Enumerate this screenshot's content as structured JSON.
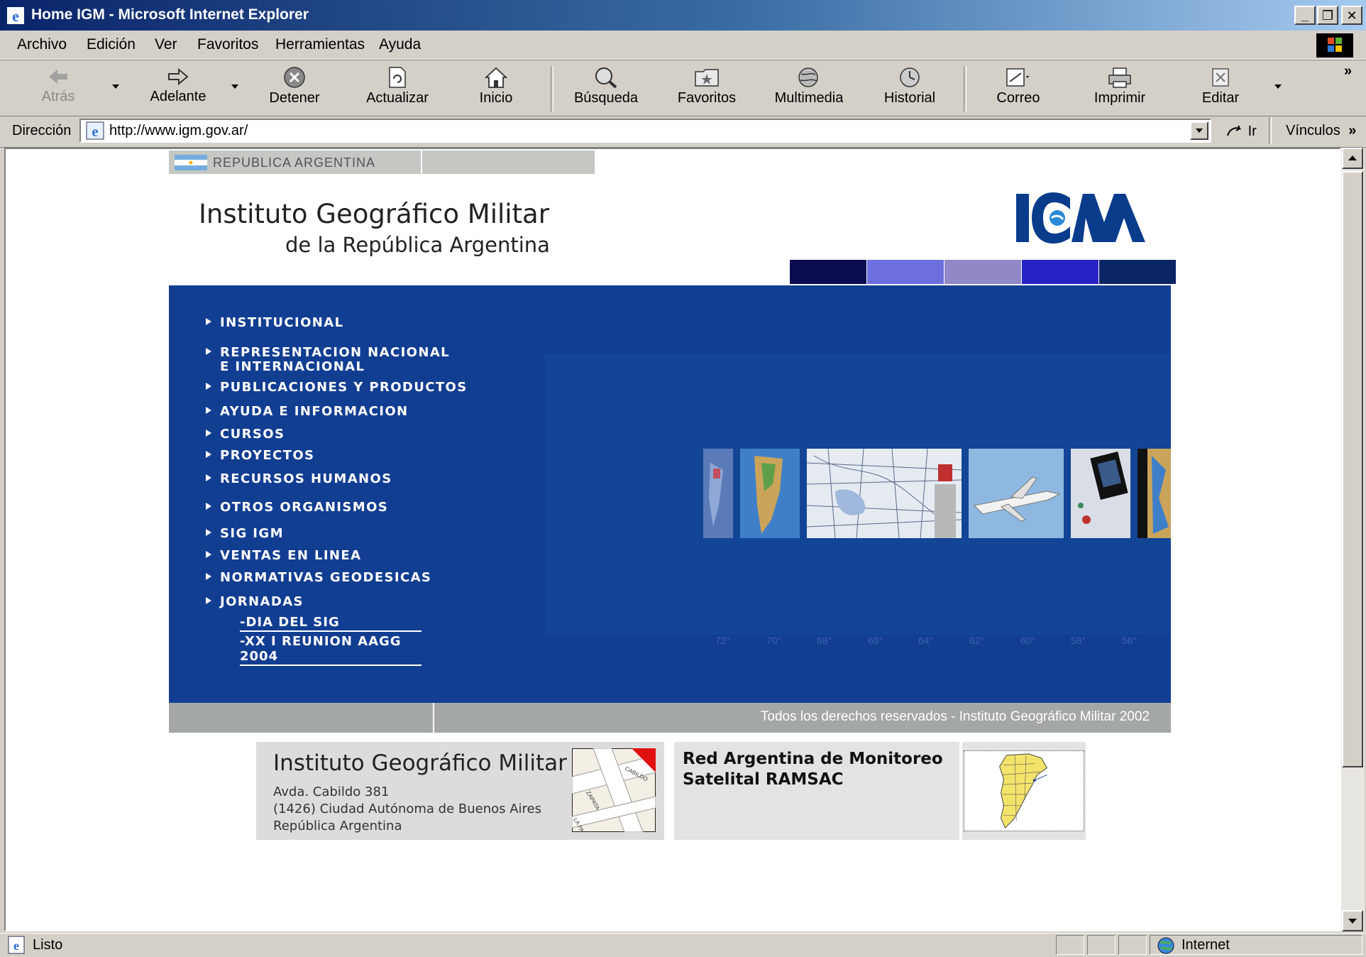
{
  "window": {
    "title": "Home IGM - Microsoft Internet Explorer"
  },
  "menu": [
    {
      "label": "Archivo",
      "accel": "A"
    },
    {
      "label": "Edición",
      "accel": "E"
    },
    {
      "label": "Ver",
      "accel": "V"
    },
    {
      "label": "Favoritos",
      "accel": "F"
    },
    {
      "label": "Herramientas",
      "accel": "H"
    },
    {
      "label": "Ayuda",
      "accel": "u"
    }
  ],
  "toolbar": {
    "back": "Atrás",
    "forward": "Adelante",
    "stop": "Detener",
    "refresh": "Actualizar",
    "home": "Inicio",
    "search": "Búsqueda",
    "favorites": "Favoritos",
    "media": "Multimedia",
    "history": "Historial",
    "mail": "Correo",
    "print": "Imprimir",
    "edit": "Editar",
    "more": "»"
  },
  "address": {
    "label": "Dirección",
    "url": "http://www.igm.gov.ar/",
    "go": "Ir",
    "links": "Vínculos"
  },
  "page": {
    "republica": "REPUBLICA ARGENTINA",
    "inst_line1": "Instituto Geográfico Militar",
    "inst_line2": "de la República Argentina",
    "logo_text": "IGM",
    "color_bars": [
      "#0b0b4f",
      "#6c6fdd",
      "#9188c7",
      "#2623c5",
      "#0a2464"
    ],
    "nav": [
      "INSTITUCIONAL",
      "REPRESENTACION NACIONAL",
      "E INTERNACIONAL",
      "PUBLICACIONES Y PRODUCTOS",
      "AYUDA E INFORMACION",
      "CURSOS",
      "PROYECTOS",
      "RECURSOS HUMANOS",
      "OTROS ORGANISMOS",
      "SIG IGM",
      "VENTAS EN LINEA",
      "NORMATIVAS GEODESICAS",
      "JORNADAS"
    ],
    "subnav": [
      "-DIA DEL SIG",
      "-XX I REUNION AAGG 2004"
    ],
    "degrees": [
      "72°",
      "70°",
      "68°",
      "66°",
      "64°",
      "62°",
      "60°",
      "58°",
      "56°"
    ],
    "footer": "Todos los derechos reservados - Instituto Geográfico Militar 2002",
    "address_card": {
      "title": "Instituto Geográfico Militar",
      "lines": [
        "Avda. Cabildo 381",
        "(1426) Ciudad Autónoma de Buenos Aires",
        "República Argentina"
      ],
      "map_labels": [
        "CABILDO",
        "ZAPATA",
        "LA PAZ"
      ]
    },
    "ramsac": {
      "line1": "Red Argentina de Monitoreo",
      "line2": "Satelital RAMSAC"
    }
  },
  "status": {
    "text": "Listo",
    "zone": "Internet"
  }
}
